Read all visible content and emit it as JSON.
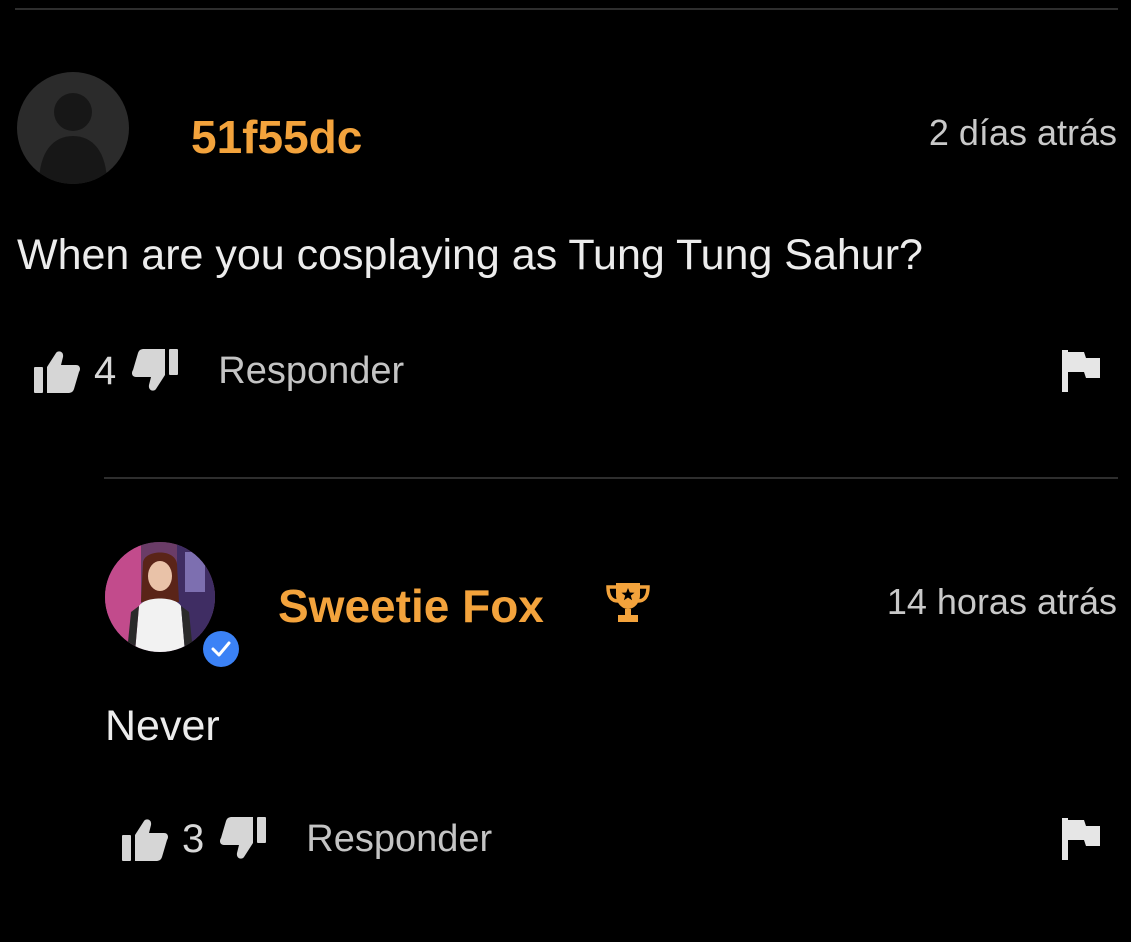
{
  "comments": [
    {
      "username": "51f55dc",
      "time": "2 días atrás",
      "text": "When are you cosplaying as Tung Tung Sahur?",
      "likes": "4",
      "reply_label": "Responder",
      "avatar": "default-user-silhouette"
    }
  ],
  "replies": [
    {
      "username": "Sweetie Fox",
      "time": "14 horas atrás",
      "text": "Never",
      "likes": "3",
      "reply_label": "Responder",
      "badge": "trophy-icon",
      "verified": true
    }
  ],
  "colors": {
    "background": "#000000",
    "username": "#f3a33c",
    "text": "#ececec",
    "muted": "#c4c4c4",
    "verified": "#3b82f6",
    "divider": "#2e2e2e"
  }
}
